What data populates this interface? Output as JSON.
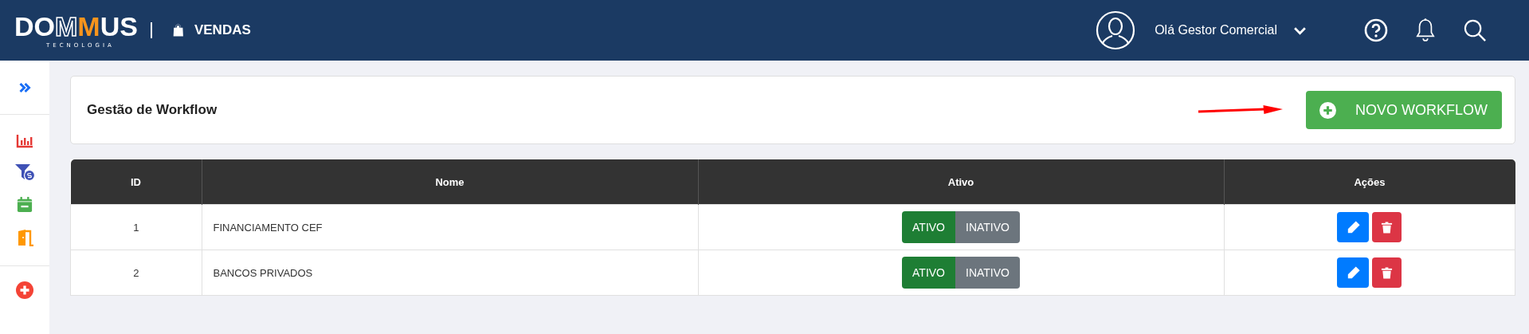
{
  "header": {
    "logo": {
      "text": "DOMMUS",
      "tagline": "TECNOLOGIA"
    },
    "module": "VENDAS",
    "greeting": "Olá Gestor Comercial"
  },
  "page": {
    "title": "Gestão de Workflow",
    "new_button": "NOVO WORKFLOW"
  },
  "table": {
    "columns": [
      "ID",
      "Nome",
      "Ativo",
      "Ações"
    ],
    "rows": [
      {
        "id": "1",
        "name": "FINANCIAMENTO CEF",
        "status": [
          {
            "label": "ATIVO",
            "selected": true
          },
          {
            "label": "INATIVO",
            "selected": false
          }
        ]
      },
      {
        "id": "2",
        "name": "BANCOS PRIVADOS",
        "status": [
          {
            "label": "ATIVO",
            "selected": true
          },
          {
            "label": "INATIVO",
            "selected": false
          }
        ]
      }
    ]
  }
}
